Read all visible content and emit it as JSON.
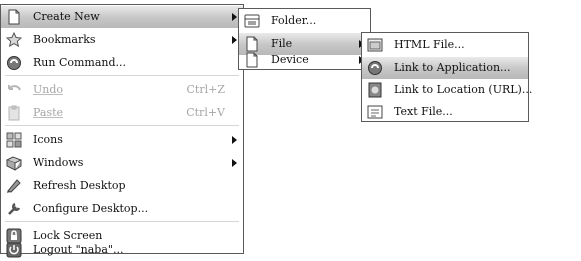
{
  "main_menu": {
    "items": [
      {
        "label": "Create New",
        "icon": "document-new-icon",
        "submenu": true,
        "highlighted": true
      },
      {
        "label": "Bookmarks",
        "icon": "star-icon",
        "submenu": true
      },
      {
        "label": "Run Command...",
        "icon": "run-command-icon"
      },
      {
        "label": "Undo",
        "icon": "undo-icon",
        "shortcut": "Ctrl+Z",
        "disabled": true
      },
      {
        "label": "Paste",
        "icon": "paste-icon",
        "shortcut": "Ctrl+V",
        "disabled": true
      },
      {
        "label": "Icons",
        "icon": "icons-icon",
        "submenu": true
      },
      {
        "label": "Windows",
        "icon": "windows-icon",
        "submenu": true
      },
      {
        "label": "Refresh Desktop",
        "icon": "refresh-icon"
      },
      {
        "label": "Configure Desktop...",
        "icon": "configure-icon"
      },
      {
        "label": "Lock Screen",
        "icon": "lock-icon"
      },
      {
        "label": "Logout \"naba\"...",
        "icon": "logout-icon"
      }
    ]
  },
  "create_new_menu": {
    "items": [
      {
        "label": "Folder...",
        "icon": "folder-icon"
      },
      {
        "label": "File",
        "icon": "file-icon",
        "submenu": true,
        "highlighted": true
      },
      {
        "label": "Device",
        "icon": "device-icon",
        "submenu": true
      }
    ]
  },
  "file_menu": {
    "items": [
      {
        "label": "HTML File...",
        "icon": "html-file-icon"
      },
      {
        "label": "Link to Application...",
        "icon": "link-application-icon",
        "highlighted": true
      },
      {
        "label": "Link to Location (URL)...",
        "icon": "link-location-icon"
      },
      {
        "label": "Text File...",
        "icon": "text-file-icon"
      }
    ]
  },
  "colors": {
    "highlight": "#c8c8c8",
    "border": "#5a5a5a",
    "disabled_text": "#a6a6a6"
  }
}
